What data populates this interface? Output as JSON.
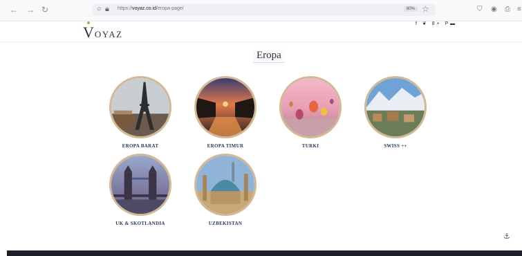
{
  "browser": {
    "back_icon": "back-arrow-icon",
    "forward_icon": "forward-arrow-icon",
    "reload_icon": "reload-icon",
    "url_prefix": "https://",
    "url_domain": "voyaz.co.id",
    "url_path": "/eropa-page/",
    "zoom": "80%"
  },
  "site": {
    "logo_v": "V",
    "logo_rest": "OYAZ",
    "social": "f ❦ 8+ P",
    "cart_glyph": "▬"
  },
  "page": {
    "title": "Eropa"
  },
  "destinations": [
    {
      "label": "EROPA BARAT",
      "image": "eiffel-tower-carousel"
    },
    {
      "label": "EROPA TIMUR",
      "image": "canal-sunset-city"
    },
    {
      "label": "TURKI",
      "image": "hot-air-balloons"
    },
    {
      "label": "SWISS ++",
      "image": "alpine-village-mountains"
    },
    {
      "label": "UK & SKOTLANDIA",
      "image": "tower-bridge"
    },
    {
      "label": "UZBEKISTAN",
      "image": "mosque-dome"
    }
  ],
  "colors": {
    "circle_border": "#d2b895",
    "label_color": "#2b3a55",
    "footer": "#1a1f29"
  }
}
